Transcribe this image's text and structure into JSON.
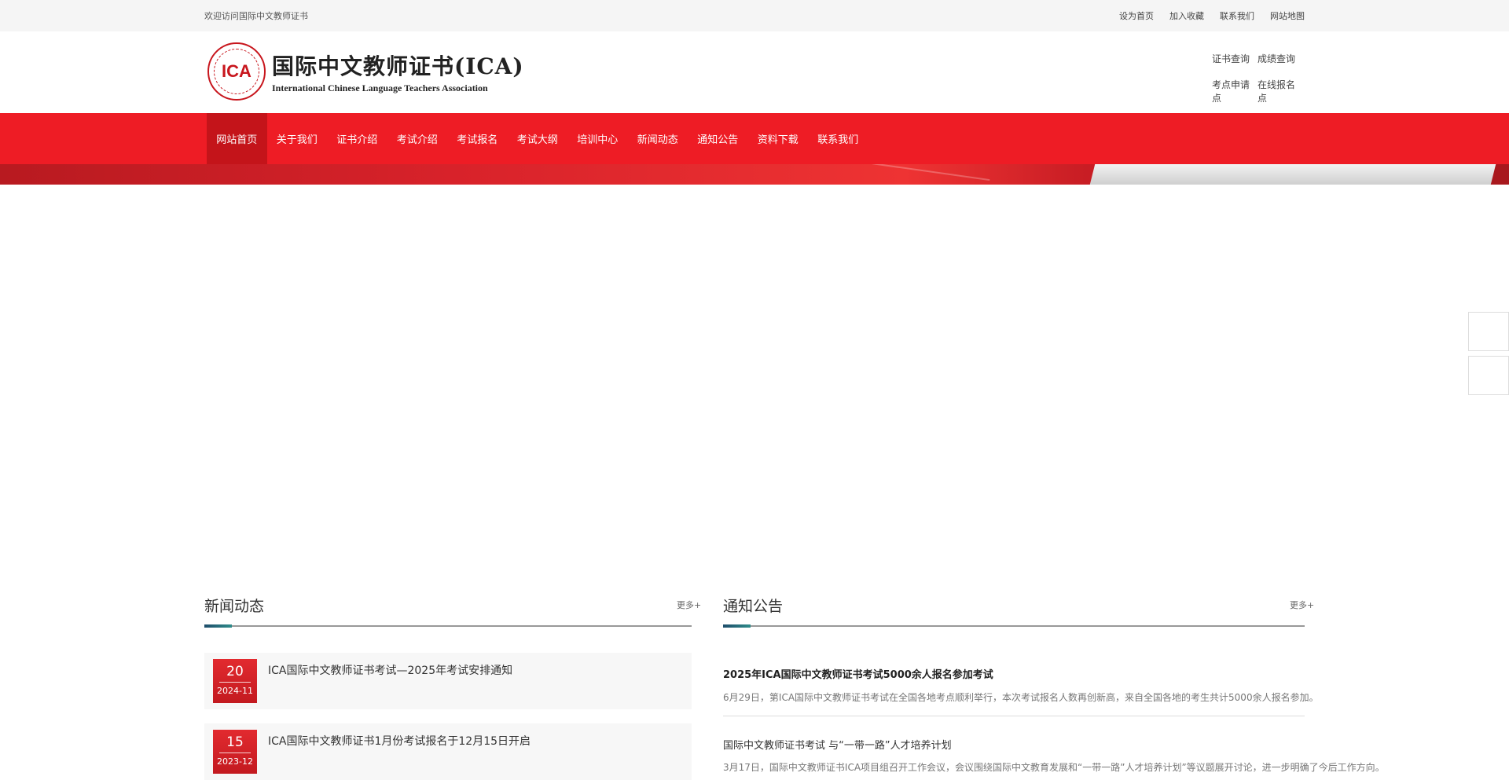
{
  "topbar": {
    "welcome": "欢迎访问国际中文教师证书",
    "links": [
      "设为首页",
      "加入收藏",
      "联系我们",
      "网站地图"
    ]
  },
  "header": {
    "logo_abbr": "ICA",
    "logo_cn": "国际中文教师证书(ICA)",
    "logo_en": "International Chinese Language Teachers Association",
    "quick_links": [
      "证书查询",
      "成绩查询",
      "考点申请点",
      "在线报名点"
    ]
  },
  "nav": {
    "items": [
      "网站首页",
      "关于我们",
      "证书介绍",
      "考试介绍",
      "考试报名",
      "考试大纲",
      "培训中心",
      "新闻动态",
      "通知公告",
      "资料下载",
      "联系我们"
    ],
    "active_index": 0
  },
  "news": {
    "title": "新闻动态",
    "more": "更多+",
    "items": [
      {
        "day": "20",
        "ym": "2024-11",
        "title": "ICA国际中文教师证书考试—2025年考试安排通知"
      },
      {
        "day": "15",
        "ym": "2023-12",
        "title": "ICA国际中文教师证书1月份考试报名于12月15日开启"
      }
    ]
  },
  "notices": {
    "title": "通知公告",
    "more": "更多+",
    "items": [
      {
        "title": "2025年ICA国际中文教师证书考试5000余人报名参加考试",
        "desc": "6月29日，第ICA国际中文教师证书考试在全国各地考点顺利举行，本次考试报名人数再创新高，来自全国各地的考生共计5000余人报名参加。"
      },
      {
        "title": "国际中文教师证书考试 与“一带一路”人才培养计划",
        "desc": "3月17日，国际中文教师证书ICA项目组召开工作会议，会议围绕国际中文教育发展和“一带一路”人才培养计划”等议题展开讨论，进一步明确了今后工作方向。"
      }
    ]
  }
}
